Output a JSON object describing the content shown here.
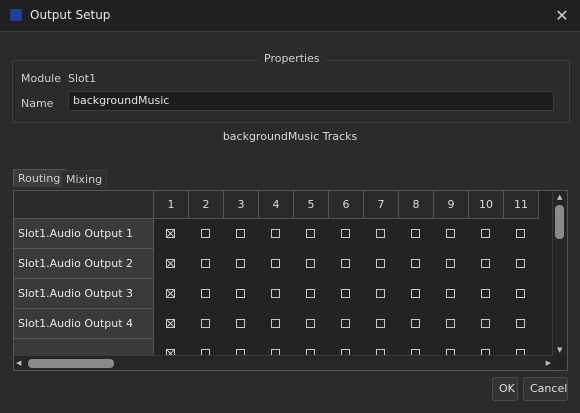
{
  "window": {
    "title": "Output Setup",
    "close_glyph": "✕"
  },
  "properties": {
    "title": "Properties",
    "module_label": "Module",
    "module_value": "Slot1",
    "name_label": "Name",
    "name_value": "backgroundMusic"
  },
  "tracks_title": "backgroundMusic Tracks",
  "tabs": [
    {
      "label": "Routing",
      "active": true
    },
    {
      "label": "Mixing",
      "active": false
    }
  ],
  "columns": [
    "1",
    "2",
    "3",
    "4",
    "5",
    "6",
    "7",
    "8",
    "9",
    "10",
    "11"
  ],
  "rows": [
    {
      "label": "Slot1.Audio Output 1",
      "checked": [
        true,
        false,
        false,
        false,
        false,
        false,
        false,
        false,
        false,
        false,
        false
      ]
    },
    {
      "label": "Slot1.Audio Output 2",
      "checked": [
        true,
        false,
        false,
        false,
        false,
        false,
        false,
        false,
        false,
        false,
        false
      ]
    },
    {
      "label": "Slot1.Audio Output 3",
      "checked": [
        true,
        false,
        false,
        false,
        false,
        false,
        false,
        false,
        false,
        false,
        false
      ]
    },
    {
      "label": "Slot1.Audio Output 4",
      "checked": [
        true,
        false,
        false,
        false,
        false,
        false,
        false,
        false,
        false,
        false,
        false
      ]
    },
    {
      "label": "",
      "checked": [
        true,
        false,
        false,
        false,
        false,
        false,
        false,
        false,
        false,
        false,
        false
      ]
    }
  ],
  "buttons": {
    "ok": "OK",
    "cancel": "Cancel"
  },
  "icons": {
    "app": "app-icon",
    "close": "close-icon",
    "scroll_up": "▲",
    "scroll_down": "▼",
    "scroll_left": "◀",
    "scroll_right": "▶"
  },
  "colors": {
    "accent": "#1e3f9a",
    "background": "#2b2b2b"
  }
}
